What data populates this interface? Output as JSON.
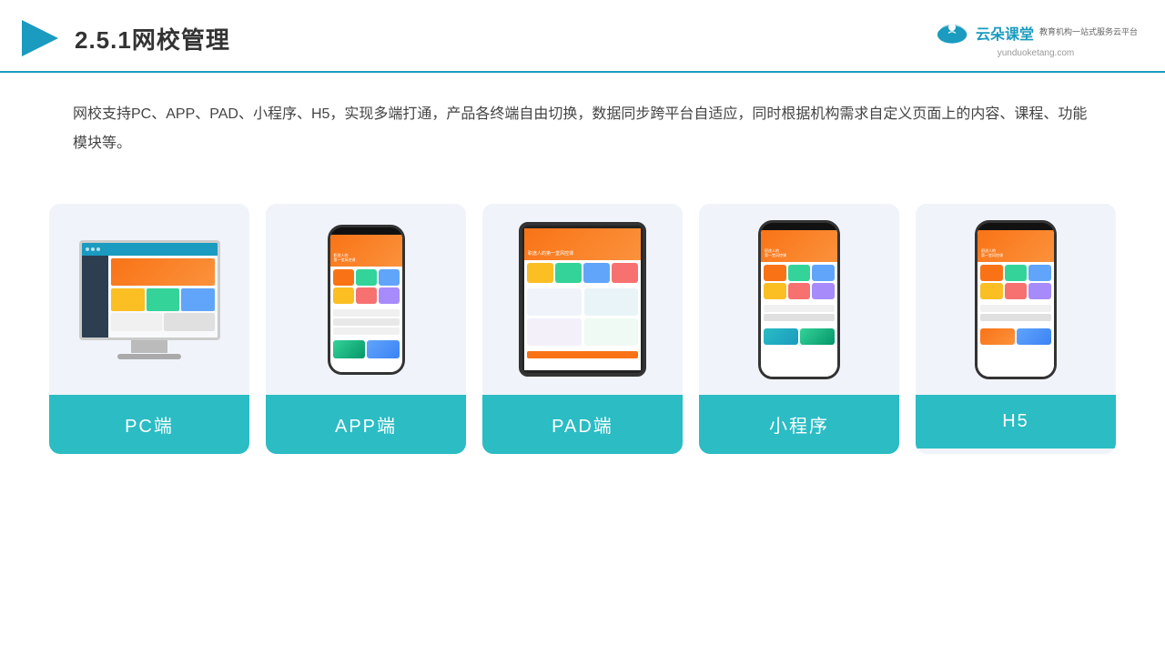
{
  "header": {
    "title": "2.5.1网校管理",
    "logo_text": "云朵课堂",
    "logo_url": "yunduoketang.com",
    "logo_sub": "教育机构一站式服务云平台"
  },
  "description": {
    "text": "网校支持PC、APP、PAD、小程序、H5，实现多端打通，产品各终端自由切换，数据同步跨平台自适应，同时根据机构需求自定义页面上的内容、课程、功能模块等。"
  },
  "cards": [
    {
      "id": "pc",
      "label": "PC端",
      "type": "pc"
    },
    {
      "id": "app",
      "label": "APP端",
      "type": "phone"
    },
    {
      "id": "pad",
      "label": "PAD端",
      "type": "tablet"
    },
    {
      "id": "miniapp",
      "label": "小程序",
      "type": "phone"
    },
    {
      "id": "h5",
      "label": "H5",
      "type": "phone"
    }
  ],
  "colors": {
    "accent": "#2bbcc4",
    "header_border": "#1a9bbf",
    "card_bg": "#f0f4fa"
  }
}
